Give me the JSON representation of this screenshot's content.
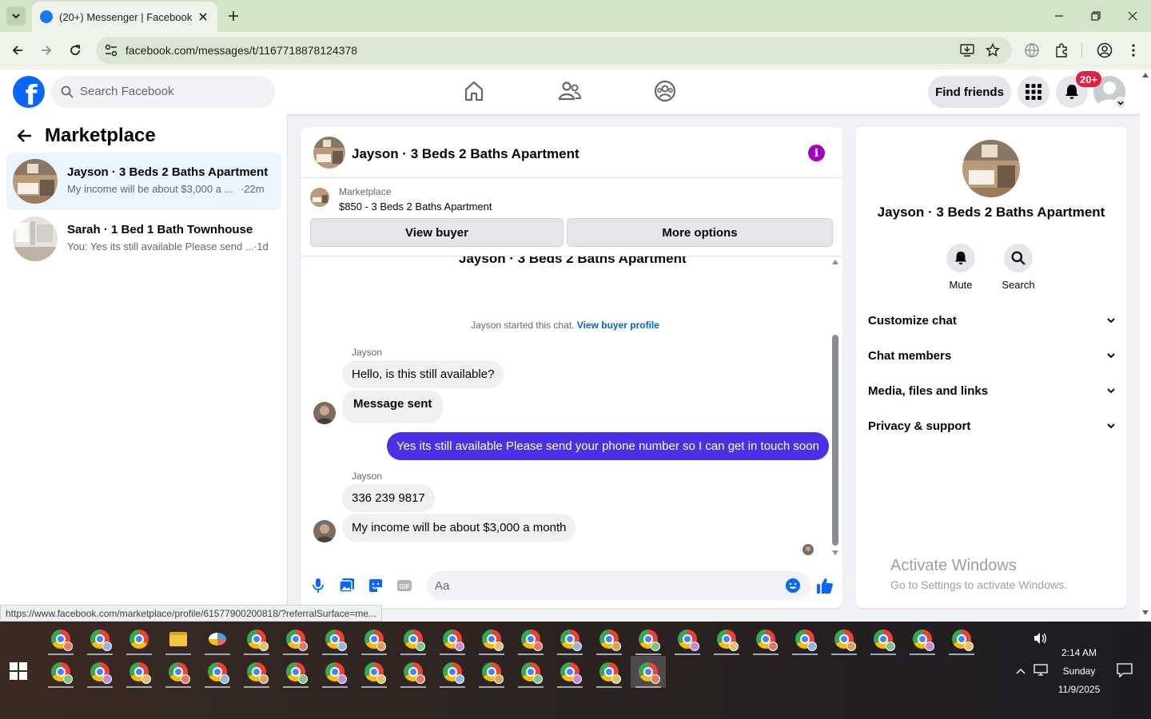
{
  "browser": {
    "tab_title": "(20+) Messenger | Facebook",
    "url": "facebook.com/messages/t/1167718878124378",
    "status_url": "https://www.facebook.com/marketplace/profile/61577900200818/?referralSurface=me..."
  },
  "fb_header": {
    "search_placeholder": "Search Facebook",
    "find_friends": "Find friends",
    "notif_badge": "20+"
  },
  "sidebar": {
    "title": "Marketplace",
    "conversations": [
      {
        "name": "Jayson · 3 Beds 2 Baths Apartment",
        "snippet": "My income will be about $3,000 a ...",
        "time": "·22m",
        "active": true
      },
      {
        "name": "Sarah · 1 Bed 1 Bath Townhouse",
        "snippet": "You: Yes its still available Please send ...",
        "time": "·1d",
        "active": false
      }
    ]
  },
  "chat": {
    "title": "Jayson · 3 Beds 2 Baths Apartment",
    "marketplace_label": "Marketplace",
    "listing": "$850 - 3 Beds 2 Baths Apartment",
    "view_buyer": "View buyer",
    "more_options": "More options",
    "thread_title": "Jayson · 3 Beds 2 Baths Apartment",
    "started_text": "Jayson started this chat.",
    "started_link": "View buyer profile",
    "sender1": "Jayson",
    "msg1": "Hello, is this still available?",
    "msg2": "Message sent",
    "msg3": "Yes its still available Please send your phone number so I can get in touch soon",
    "sender2": "Jayson",
    "msg4": "336 239 9817",
    "msg5": "My income will be about $3,000 a month",
    "composer_placeholder": "Aa"
  },
  "info_panel": {
    "name": "Jayson · 3 Beds 2 Baths Apartment",
    "mute": "Mute",
    "search": "Search",
    "rows": [
      "Customize chat",
      "Chat members",
      "Media, files and links",
      "Privacy & support"
    ],
    "watermark_title": "Activate Windows",
    "watermark_sub": "Go to Settings to activate Windows."
  },
  "taskbar": {
    "time": "2:14 AM",
    "day": "Sunday",
    "date": "11/9/2025"
  },
  "colors": {
    "fb_blue": "#0866ff",
    "outgoing_bubble": "#4a31e8",
    "info_icon": "#a100c2",
    "active_conv": "#ebf5ff"
  }
}
